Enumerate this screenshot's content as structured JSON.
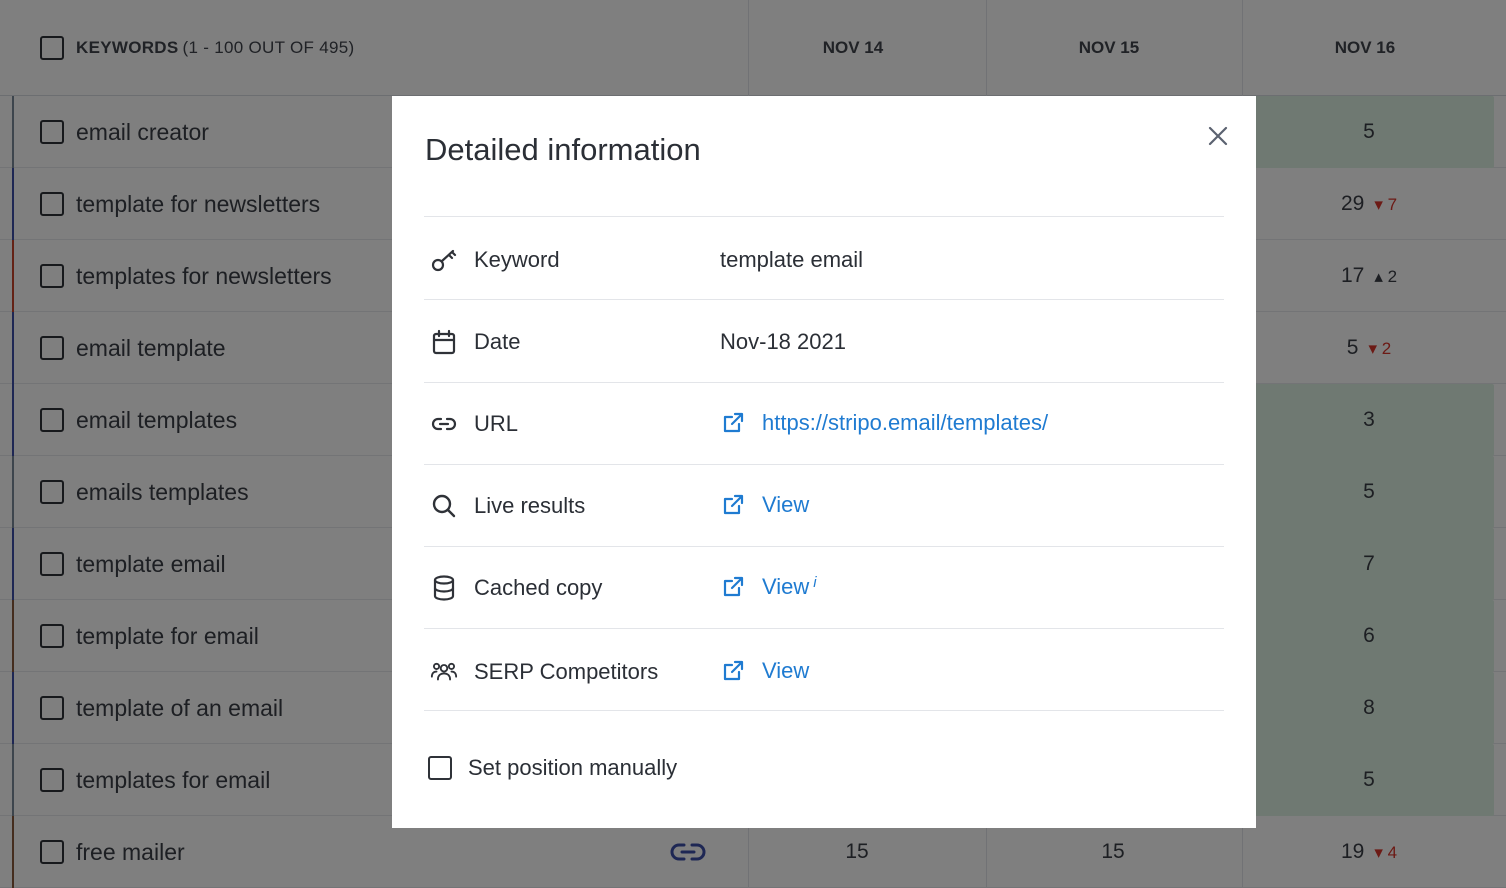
{
  "table": {
    "header": {
      "keywords_label": "KEYWORDS",
      "keywords_count": "(1 - 100 OUT OF 495)",
      "dates": [
        "NOV 14",
        "NOV 15",
        "NOV 16"
      ]
    },
    "rows": [
      {
        "keyword": "email creator",
        "nov16": "5",
        "change": "",
        "dir": "",
        "accent": "#7a8a9a"
      },
      {
        "keyword": "template for newsletters",
        "nov16": "29",
        "change": "7",
        "dir": "down",
        "accent": "#3d4fa8"
      },
      {
        "keyword": "templates for newsletters",
        "nov16": "17",
        "change": "2",
        "dir": "up",
        "accent": "#c8452b"
      },
      {
        "keyword": "email template",
        "nov16": "5",
        "change": "2",
        "dir": "down",
        "accent": "#3d4fa8"
      },
      {
        "keyword": "email templates",
        "nov16": "3",
        "change": "",
        "dir": "",
        "accent": "#3d4fa8"
      },
      {
        "keyword": "emails templates",
        "nov16": "5",
        "change": "",
        "dir": "",
        "accent": "#7a8a9a"
      },
      {
        "keyword": "template email",
        "nov16": "7",
        "change": "",
        "dir": "",
        "accent": "#3d4fa8"
      },
      {
        "keyword": "template for email",
        "nov16": "6",
        "change": "",
        "dir": "",
        "accent": "#8b5a3c"
      },
      {
        "keyword": "template of an email",
        "nov16": "8",
        "change": "",
        "dir": "",
        "accent": "#3d4fa8"
      },
      {
        "keyword": "templates for email",
        "nov16": "5",
        "change": "",
        "dir": "",
        "accent": "#7a8a9a"
      },
      {
        "keyword": "free mailer",
        "nov14": "15",
        "nov15": "15",
        "nov16": "19",
        "change": "4",
        "dir": "down",
        "accent": "#8b5a3c"
      }
    ]
  },
  "modal": {
    "title": "Detailed information",
    "rows": [
      {
        "icon": "key-icon",
        "label": "Keyword",
        "value": "template email"
      },
      {
        "icon": "calendar-icon",
        "label": "Date",
        "value": "Nov-18 2021"
      },
      {
        "icon": "link-icon",
        "label": "URL",
        "link": "https://stripo.email/templates/"
      },
      {
        "icon": "search-icon",
        "label": "Live results",
        "link": "View"
      },
      {
        "icon": "database-icon",
        "label": "Cached copy",
        "link": "View",
        "info": "i"
      },
      {
        "icon": "users-icon",
        "label": "SERP Competitors",
        "link": "View"
      }
    ],
    "manual_label": "Set position manually"
  },
  "colors": {
    "link": "#1f7bd1",
    "down": "#d9342b",
    "green_cell": "#dff3e4"
  }
}
